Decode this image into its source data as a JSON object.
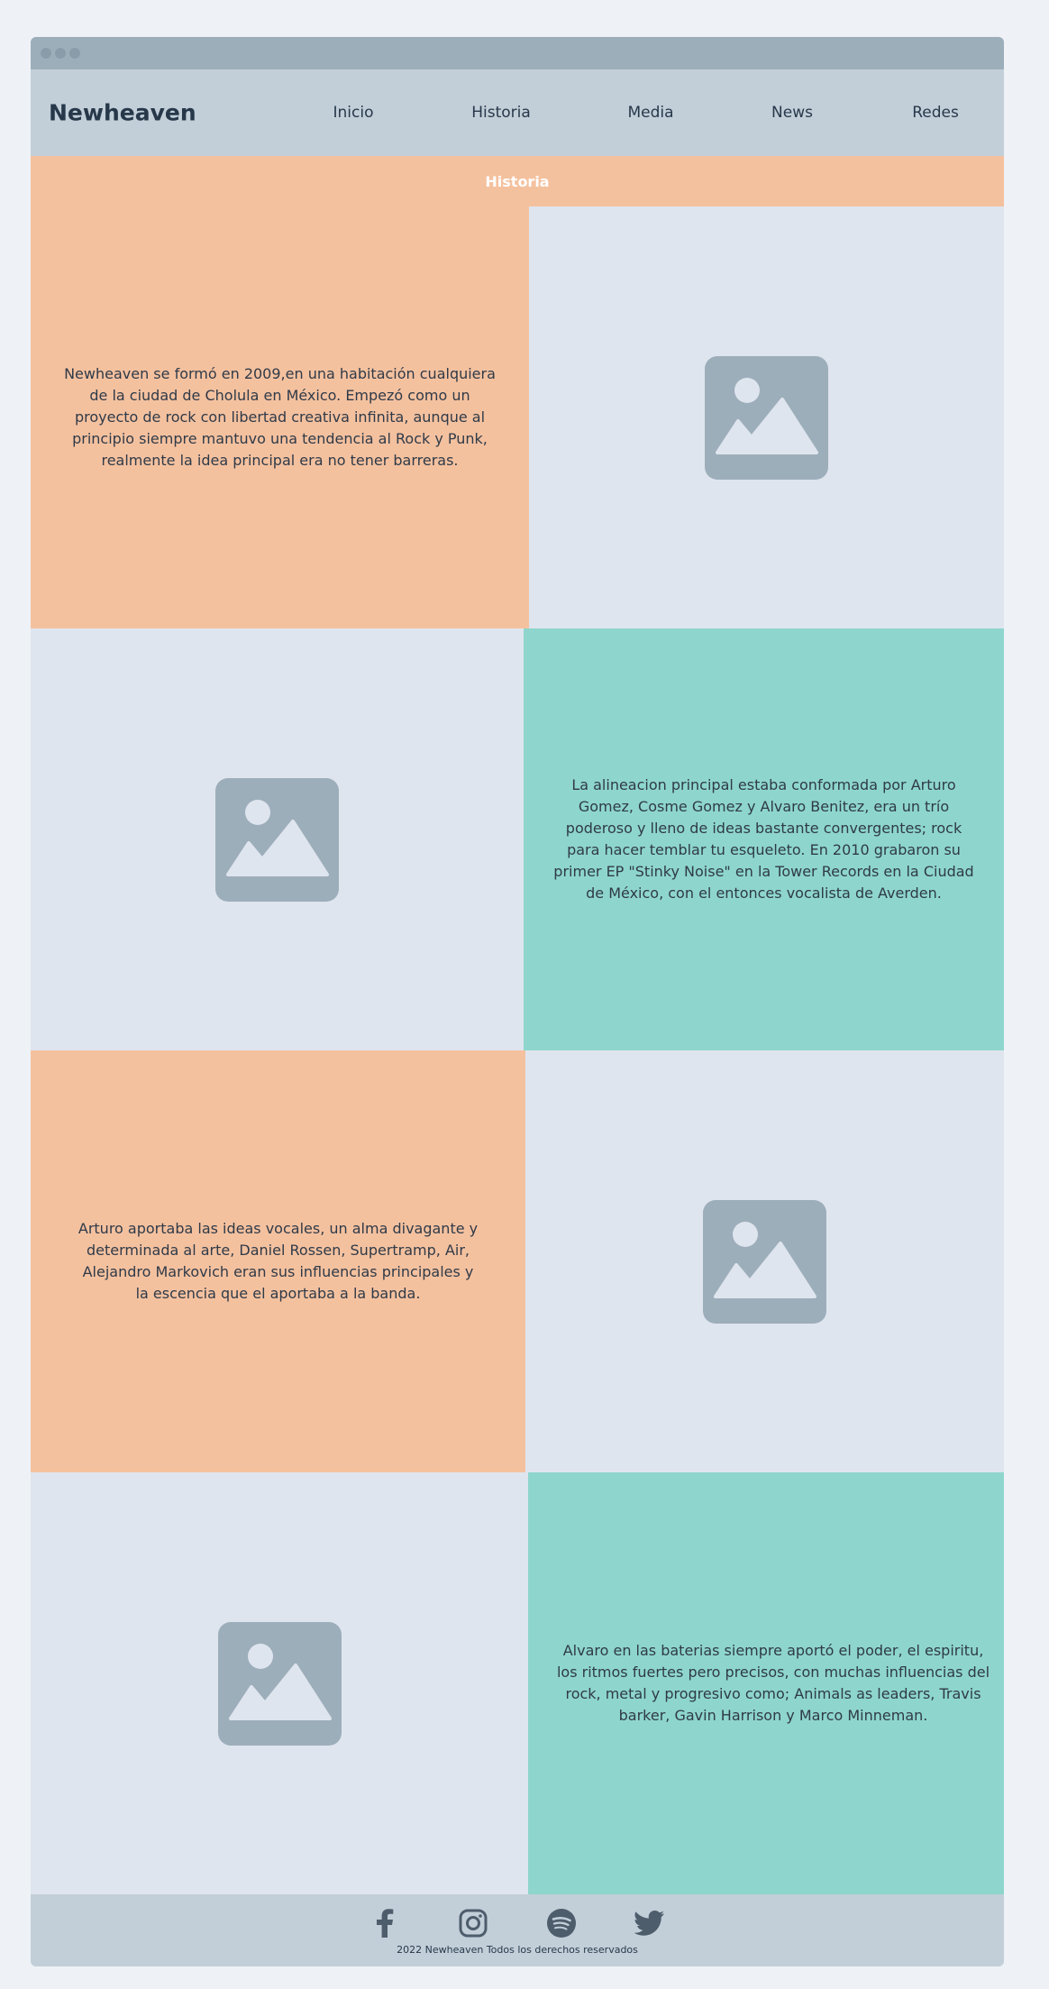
{
  "site": {
    "brand": "Newheaven",
    "nav": [
      {
        "label": "Inicio"
      },
      {
        "label": "Historia"
      },
      {
        "label": "Media"
      },
      {
        "label": "News"
      },
      {
        "label": "Redes"
      }
    ]
  },
  "section": {
    "title": "Historia"
  },
  "rows": [
    {
      "text": "Newheaven se formó en 2009,en una habitación cualquiera de la ciudad de Cholula en México. Empezó como un proyecto de rock con libertad creativa infinita, aunque al principio siempre mantuvo una tendencia al Rock y Punk, realmente la idea principal era no tener barreras."
    },
    {
      "text": "La alineacion principal estaba conformada por Arturo Gomez, Cosme Gomez y Alvaro Benitez, era un trío poderoso y lleno de ideas bastante convergentes; rock para hacer temblar tu esqueleto. En 2010 grabaron su primer EP \"Stinky Noise\" en la Tower Records en la Ciudad de México, con el entonces vocalista de Averden."
    },
    {
      "text": "Arturo aportaba las ideas vocales, un alma divagante y determinada al arte, Daniel Rossen, Supertramp, Air, Alejandro Markovich eran sus influencias principales y la escencia que el aportaba a la banda."
    },
    {
      "text": "Alvaro en las baterias siempre aportó el poder, el espiritu, los ritmos fuertes pero precisos, con muchas influencias del rock, metal y progresivo como; Animals as leaders, Travis barker, Gavin Harrison y Marco Minneman."
    }
  ],
  "footer": {
    "icons": [
      "facebook-icon",
      "instagram-icon",
      "spotify-icon",
      "twitter-icon"
    ],
    "copyright": "2022 Newheaven Todos los derechos reservados"
  },
  "colors": {
    "peach": "#f4c19f",
    "teal": "#8ed6cd",
    "nav": "#c2cfd9",
    "placeholder": "#9daebb"
  }
}
